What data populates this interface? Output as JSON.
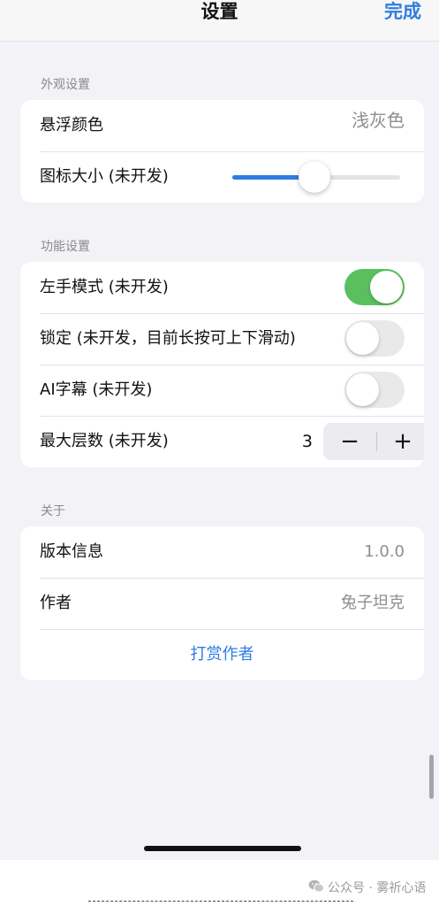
{
  "navbar": {
    "title": "设置",
    "done_label": "完成"
  },
  "appearance": {
    "header": "外观设置",
    "float_color": {
      "label": "悬浮颜色",
      "value": "浅灰色"
    },
    "icon_size": {
      "label": "图标大小 (未开发)",
      "slider_value": 0.49
    }
  },
  "features": {
    "header": "功能设置",
    "left_hand": {
      "label": "左手模式 (未开发)",
      "on": true
    },
    "lock": {
      "label": "锁定 (未开发，目前长按可上下滑动)",
      "on": false
    },
    "ai_subtitle": {
      "label": "AI字幕 (未开发)",
      "on": false
    },
    "max_layers": {
      "label": "最大层数 (未开发)",
      "value": "3",
      "minus_label": "−",
      "plus_label": "+"
    }
  },
  "about": {
    "header": "关于",
    "version": {
      "label": "版本信息",
      "value": "1.0.0"
    },
    "author": {
      "label": "作者",
      "value": "兔子坦克"
    },
    "tip_link": "打赏作者"
  },
  "watermark": {
    "text": "公众号 · 雾祈心语"
  },
  "colors": {
    "accent": "#2f7de1",
    "toggle_on": "#5ac05e",
    "background": "#f2f2f7"
  }
}
